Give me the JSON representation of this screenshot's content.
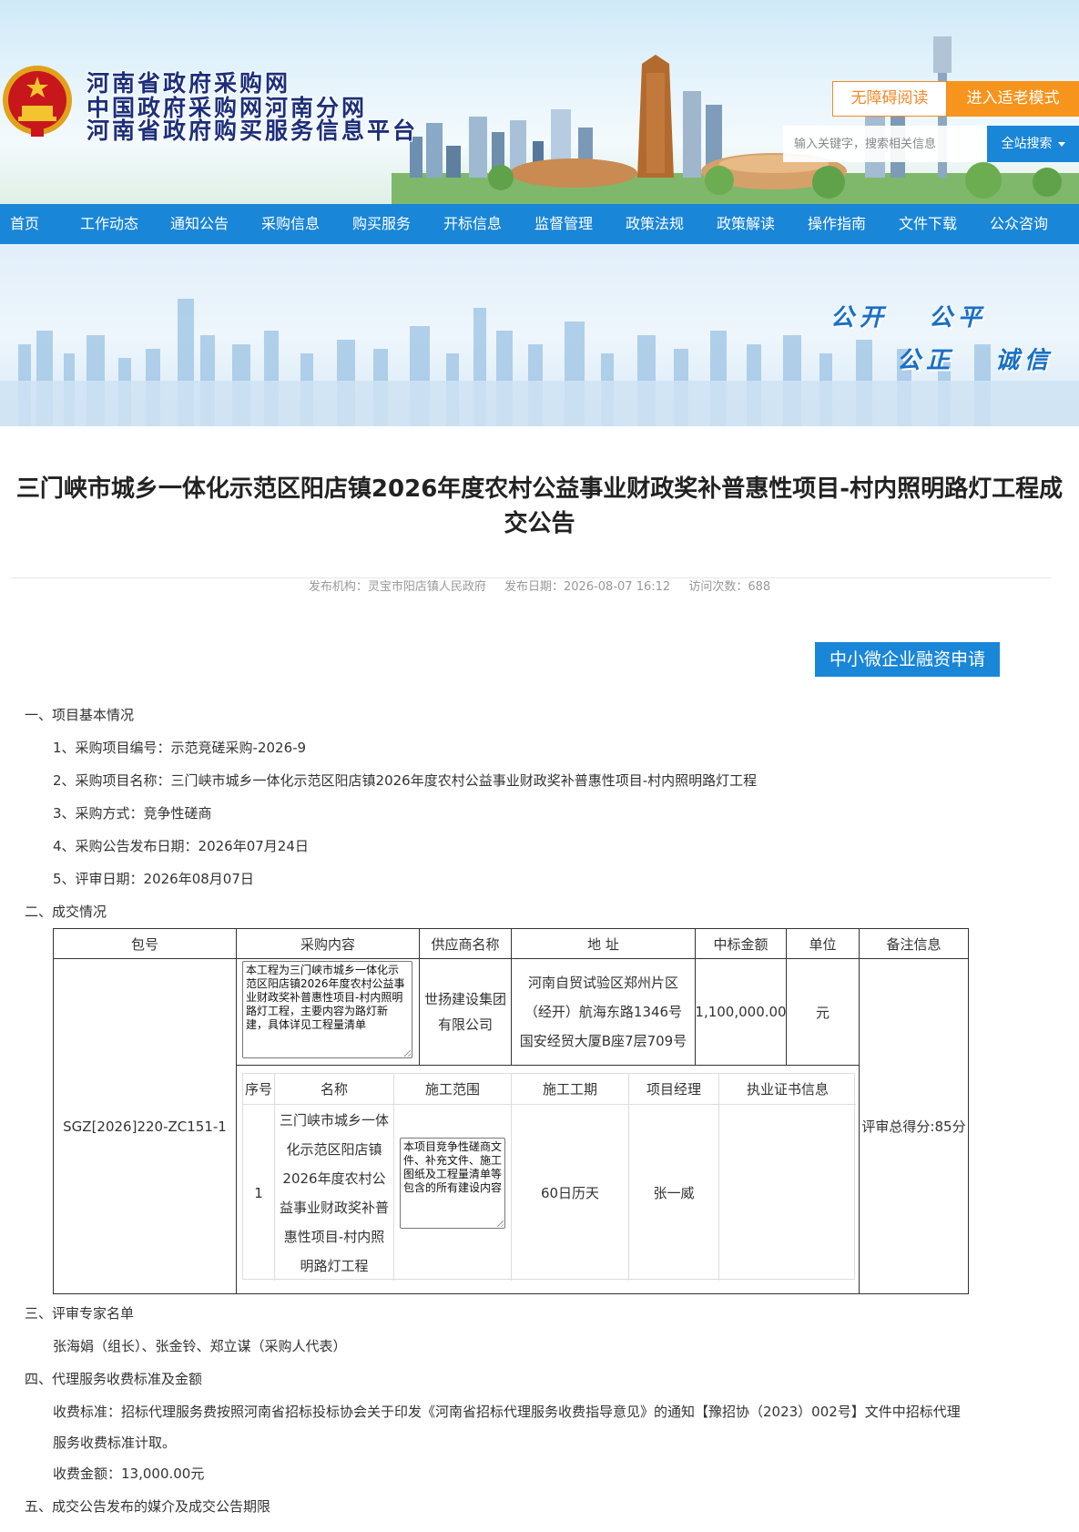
{
  "header": {
    "title_line1": "河南省政府采购网",
    "title_line2": "中国政府采购网河南分网",
    "title_line3": "河南省政府购买服务信息平台",
    "accessibility_label": "无障碍阅读",
    "elder_mode_label": "进入适老模式",
    "search_placeholder": "输入关键字，搜索相关信息",
    "search_button_label": "全站搜索"
  },
  "nav": [
    {
      "label": "首页"
    },
    {
      "label": "工作动态"
    },
    {
      "label": "通知公告"
    },
    {
      "label": "采购信息"
    },
    {
      "label": "购买服务"
    },
    {
      "label": "开标信息"
    },
    {
      "label": "监督管理"
    },
    {
      "label": "政策法规"
    },
    {
      "label": "政策解读"
    },
    {
      "label": "操作指南"
    },
    {
      "label": "文件下载"
    },
    {
      "label": "公众咨询"
    }
  ],
  "banner": {
    "slogan_1": "公开",
    "slogan_2": "公平",
    "slogan_3": "公正",
    "slogan_4": "诚信"
  },
  "article": {
    "title": "三门峡市城乡一体化示范区阳店镇2026年度农村公益事业财政奖补普惠性项目-村内照明路灯工程成交公告",
    "publisher": "发布机构：灵宝市阳店镇人民政府",
    "publish_date": "发布日期：2026-08-07 16:12",
    "visits": "访问次数：688",
    "finance_button": "中小微企业融资申请",
    "section1": {
      "heading": "一、项目基本情况",
      "items": [
        "1、采购项目编号：示范竞磋采购-2026-9",
        "2、采购项目名称：三门峡市城乡一体化示范区阳店镇2026年度农村公益事业财政奖补普惠性项目-村内照明路灯工程",
        "3、采购方式：竞争性磋商",
        "4、采购公告发布日期：2026年07月24日",
        "5、评审日期：2026年08月07日"
      ]
    },
    "section2": {
      "heading": "二、成交情况"
    },
    "table": {
      "headers": [
        "包号",
        "采购内容",
        "供应商名称",
        "地 址",
        "中标金额",
        "单位",
        "备注信息"
      ],
      "package_no": "SGZ[2026]220-ZC151-1",
      "content": "本工程为三门峡市城乡一体化示范区阳店镇2026年度农村公益事业财政奖补普惠性项目-村内照明路灯工程，主要内容为路灯新建，具体详见工程量清单",
      "supplier": "世扬建设集团有限公司",
      "address": "河南自贸试验区郑州片区（经开）航海东路1346号国安经贸大厦B座7层709号",
      "amount": "1,100,000.00",
      "unit": "元",
      "remark": "评审总得分:85分",
      "sub_headers": [
        "序号",
        "名称",
        "施工范围",
        "施工工期",
        "项目经理",
        "执业证书信息"
      ],
      "sub_row": {
        "no": "1",
        "name": "三门峡市城乡一体化示范区阳店镇2026年度农村公益事业财政奖补普惠性项目-村内照明路灯工程",
        "scope": "本项目竞争性磋商文件、补充文件、施工图纸及工程量清单等包含的所有建设内容",
        "period": "60日历天",
        "manager": "张一威",
        "certificate": ""
      }
    },
    "section3": {
      "heading": "三、评审专家名单",
      "text": "张海娟（组长）、张金铃、郑立谋（采购人代表）"
    },
    "section4": {
      "heading": "四、代理服务收费标准及金额",
      "standard_line1": "收费标准：招标代理服务费按照河南省招标投标协会关于印发《河南省招标代理服务收费指导意见》的通知【豫招协（2023）002号】文件中招标代理",
      "standard_line2": "服务收费标准计取。",
      "amount": "收费金额：13,000.00元"
    },
    "section5": {
      "heading": "五、成交公告发布的媒介及成交公告期限"
    }
  },
  "colors": {
    "nav_blue": "#1a86d8",
    "elder_orange": "#f7941d",
    "title_navy": "#1d2f7a"
  }
}
